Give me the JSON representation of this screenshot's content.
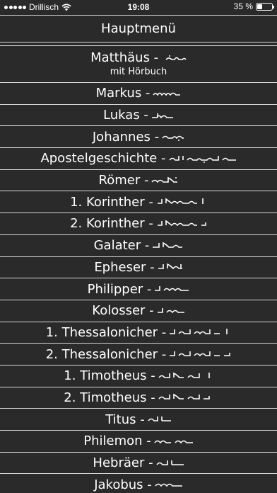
{
  "status_bar": {
    "carrier": "Drillisch",
    "time": "19:08",
    "battery_percent": "35 %",
    "battery_level": 0.35,
    "signal_icon": "signal-dots-icon",
    "wifi_icon": "wifi-icon",
    "battery_icon": "battery-icon"
  },
  "header": {
    "title": "Hauptmenü"
  },
  "colors": {
    "background": "#2a2a2a",
    "text": "#ffffff",
    "divider": "#d8d8d8"
  },
  "menu": {
    "items": [
      {
        "label": "Matthäus  -",
        "sublabel": "mit Hörbuch",
        "name": "menu-item-matthaeus"
      },
      {
        "label": "Markus -",
        "name": "menu-item-markus"
      },
      {
        "label": "Lukas -",
        "name": "menu-item-lukas"
      },
      {
        "label": "Johannes -",
        "name": "menu-item-johannes"
      },
      {
        "label": "Apostelgeschichte -",
        "name": "menu-item-apostelgeschichte"
      },
      {
        "label": "Römer -",
        "name": "menu-item-roemer"
      },
      {
        "label": "1. Korinther -",
        "name": "menu-item-1-korinther"
      },
      {
        "label": "2. Korinther -",
        "name": "menu-item-2-korinther"
      },
      {
        "label": "Galater -",
        "name": "menu-item-galater"
      },
      {
        "label": "Epheser -",
        "name": "menu-item-epheser"
      },
      {
        "label": "Philipper -",
        "name": "menu-item-philipper"
      },
      {
        "label": "Kolosser -",
        "name": "menu-item-kolosser"
      },
      {
        "label": "1. Thessalonicher -",
        "name": "menu-item-1-thessalonicher"
      },
      {
        "label": "2. Thessalonicher -",
        "name": "menu-item-2-thessalonicher"
      },
      {
        "label": "1. Timotheus -",
        "name": "menu-item-1-timotheus"
      },
      {
        "label": "2. Timotheus -",
        "name": "menu-item-2-timotheus"
      },
      {
        "label": "Titus -",
        "name": "menu-item-titus"
      },
      {
        "label": "Philemon -",
        "name": "menu-item-philemon"
      },
      {
        "label": "Hebräer -",
        "name": "menu-item-hebraeer"
      },
      {
        "label": "Jakobus -",
        "name": "menu-item-jakobus"
      }
    ]
  }
}
